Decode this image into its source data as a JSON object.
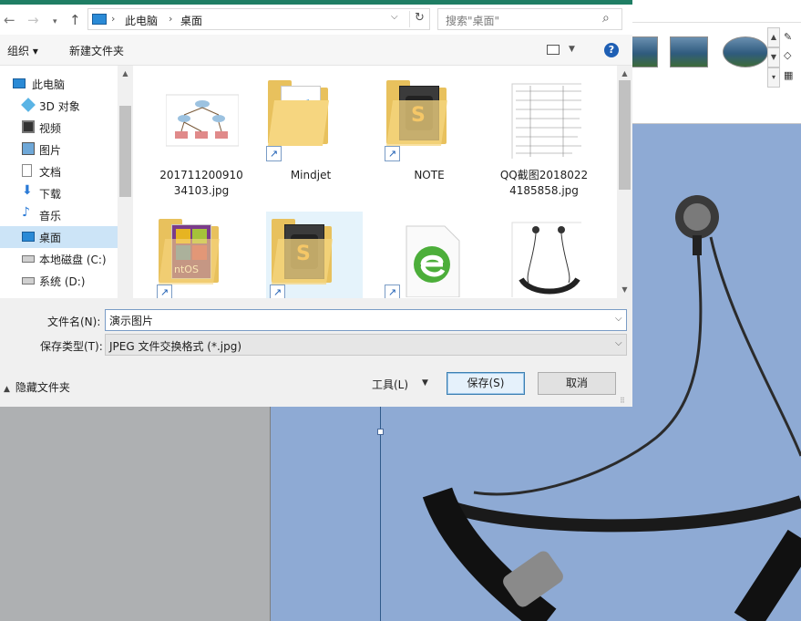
{
  "dialog": {
    "nav": {
      "back_icon": "arrow-left-icon",
      "forward_icon": "arrow-right-icon",
      "up_icon": "arrow-up-icon",
      "breadcrumb": [
        "此电脑",
        "桌面"
      ],
      "search_placeholder": "搜索\"桌面\""
    },
    "toolbar": {
      "organize_label": "组织 ▾",
      "new_folder_label": "新建文件夹",
      "help_label": "?"
    },
    "sidebar": {
      "items": [
        {
          "label": "此电脑",
          "icon": "computer-icon"
        },
        {
          "label": "3D 对象",
          "icon": "cube-icon"
        },
        {
          "label": "视频",
          "icon": "video-icon"
        },
        {
          "label": "图片",
          "icon": "picture-icon"
        },
        {
          "label": "文档",
          "icon": "document-icon"
        },
        {
          "label": "下载",
          "icon": "download-icon"
        },
        {
          "label": "音乐",
          "icon": "music-icon"
        },
        {
          "label": "桌面",
          "icon": "desktop-icon"
        },
        {
          "label": "本地磁盘 (C:)",
          "icon": "drive-icon"
        },
        {
          "label": "系统 (D:)",
          "icon": "drive-icon"
        }
      ]
    },
    "files": [
      {
        "name": "20171120091034103.jpg",
        "type": "image-diagram"
      },
      {
        "name": "Mindjet",
        "type": "folder-shortcut"
      },
      {
        "name": "NOTE",
        "type": "folder-shortcut"
      },
      {
        "name": "QQ截图20180224185858.jpg",
        "type": "image-screenshot"
      },
      {
        "name": "",
        "type": "folder-shortcut"
      },
      {
        "name": "",
        "type": "folder-shortcut"
      },
      {
        "name": "",
        "type": "browser-shortcut"
      },
      {
        "name": "",
        "type": "image-headphones"
      }
    ],
    "form": {
      "filename_label": "文件名(N):",
      "filename_value": "演示图片",
      "filetype_label": "保存类型(T):",
      "filetype_value": "JPEG 文件交换格式 (*.jpg)",
      "hide_folders_label": "隐藏文件夹",
      "tools_label": "工具(L)",
      "save_label": "保存(S)",
      "cancel_label": "取消"
    }
  }
}
